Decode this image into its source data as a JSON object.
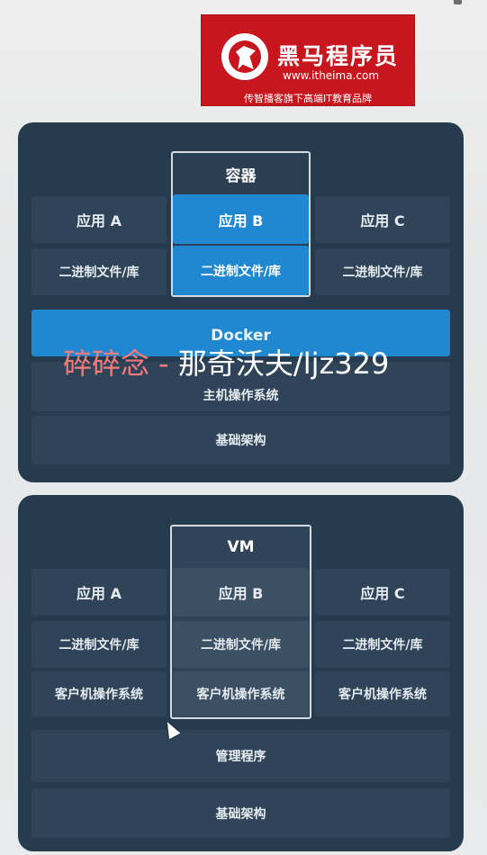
{
  "logo": {
    "name": "黑马程序员",
    "url": "www.itheima.com",
    "tagline": "传智播客旗下高端IT教育品牌"
  },
  "docker_diagram": {
    "column_title": "容器",
    "apps": [
      "应用 A",
      "应用 B",
      "应用 C"
    ],
    "bins": [
      "二进制文件/库",
      "二进制文件/库",
      "二进制文件/库"
    ],
    "engine": "Docker",
    "host_os": "主机操作系统",
    "infrastructure": "基础架构"
  },
  "vm_diagram": {
    "column_title": "VM",
    "apps": [
      "应用 A",
      "应用 B",
      "应用 C"
    ],
    "bins": [
      "二进制文件/库",
      "二进制文件/库",
      "二进制文件/库"
    ],
    "guest_os": [
      "客户机操作系统",
      "客户机操作系统",
      "客户机操作系统"
    ],
    "hypervisor": "管理程序",
    "infrastructure": "基础架构"
  },
  "watermark": {
    "prefix": "碎碎念 - ",
    "suffix": "那奇沃夫/ljz329"
  },
  "colors": {
    "panel": "#273b4f",
    "box": "#2f4458",
    "accent_blue": "#1f88d0",
    "logo_red": "#c7161d"
  }
}
